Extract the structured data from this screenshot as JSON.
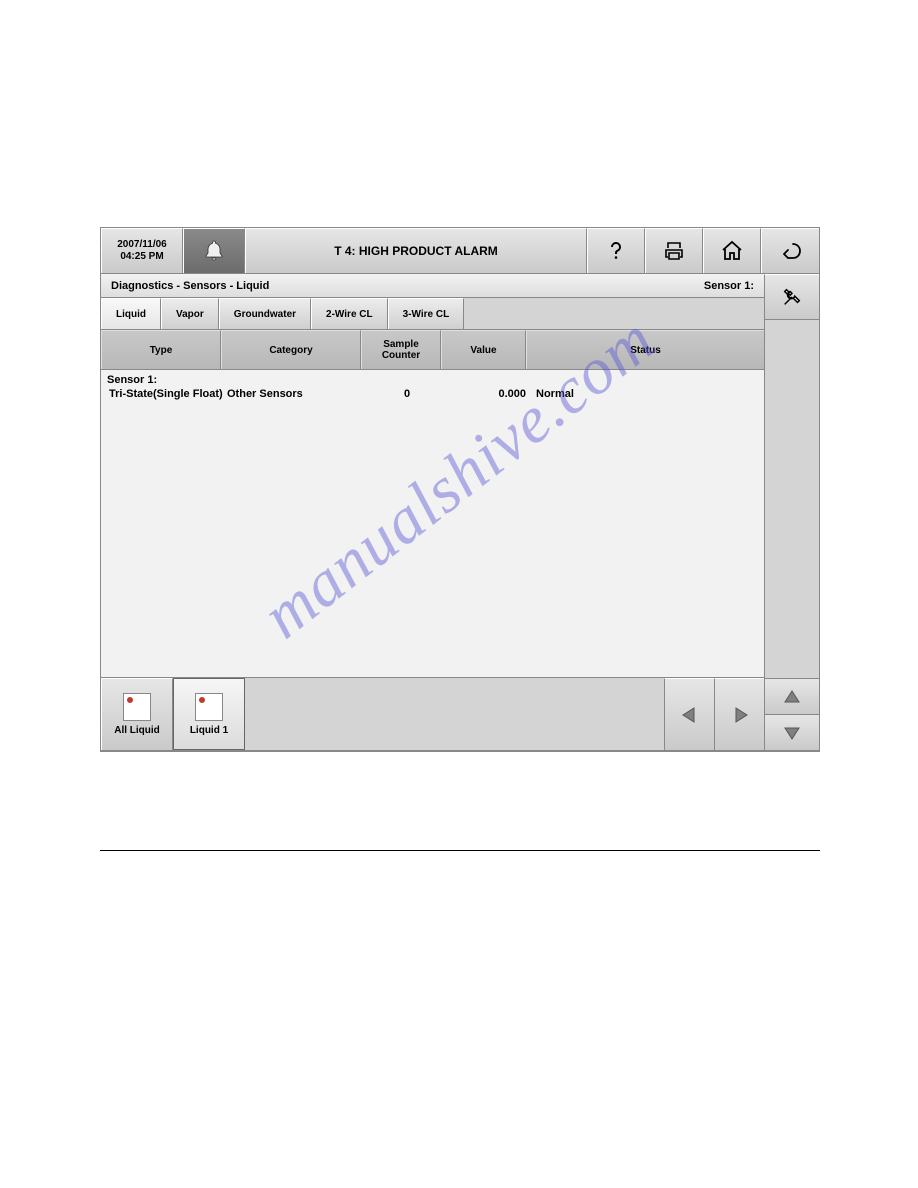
{
  "header": {
    "date": "2007/11/06",
    "time": "04:25 PM",
    "alarm_text": "T 4: HIGH PRODUCT ALARM"
  },
  "breadcrumb": {
    "path": "Diagnostics - Sensors - Liquid",
    "context": "Sensor 1:"
  },
  "tabs": {
    "items": [
      "Liquid",
      "Vapor",
      "Groundwater",
      "2-Wire CL",
      "3-Wire CL"
    ]
  },
  "table": {
    "headers": {
      "type": "Type",
      "category": "Category",
      "sample": "Sample\nCounter",
      "value": "Value",
      "status": "Status"
    },
    "sensor_label": "Sensor 1:",
    "row": {
      "type": "Tri-State(Single Float)",
      "category": "Other Sensors",
      "sample": "0",
      "value": "0.000",
      "status": "Normal"
    }
  },
  "bottom": {
    "all": "All Liquid",
    "current": "Liquid 1"
  },
  "watermark": "manualshive.com"
}
